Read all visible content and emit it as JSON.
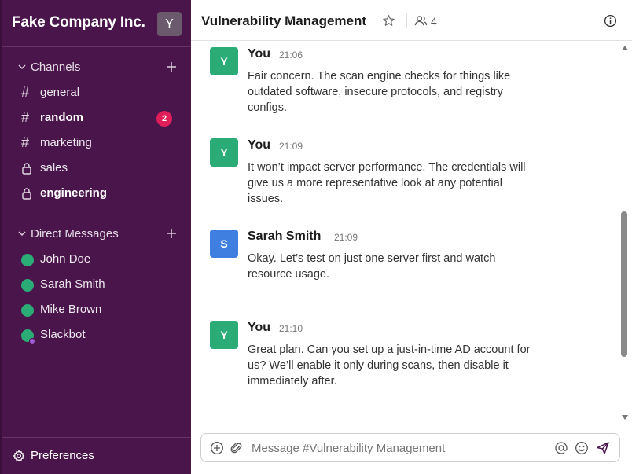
{
  "workspace": {
    "name": "Fake Company Inc.",
    "avatar_letter": "Y"
  },
  "sidebar": {
    "channels_label": "Channels",
    "channels": [
      {
        "name": "general",
        "type": "public",
        "bold": false,
        "badge": null
      },
      {
        "name": "random",
        "type": "public",
        "bold": true,
        "badge": "2"
      },
      {
        "name": "marketing",
        "type": "public",
        "bold": false,
        "badge": null
      },
      {
        "name": "sales",
        "type": "private",
        "bold": false,
        "badge": null
      },
      {
        "name": "engineering",
        "type": "private",
        "bold": true,
        "badge": null
      }
    ],
    "dm_label": "Direct Messages",
    "dms": [
      {
        "name": "John Doe",
        "status": "online"
      },
      {
        "name": "Sarah Smith",
        "status": "online"
      },
      {
        "name": "Mike Brown",
        "status": "online"
      },
      {
        "name": "Slackbot",
        "status": "online-bot"
      }
    ],
    "preferences_label": "Preferences"
  },
  "channel": {
    "title": "Vulnerability Management",
    "member_count": "4"
  },
  "messages": [
    {
      "author": "You",
      "avatar": "Y",
      "avatar_color": "#2bac76",
      "time": "21:06",
      "text": "Fair concern. The scan engine checks for things like outdated software, insecure protocols, and registry configs."
    },
    {
      "author": "You",
      "avatar": "Y",
      "avatar_color": "#2bac76",
      "time": "21:09",
      "text": "It won’t impact server performance. The credentials will give us a more representative look at any potential issues."
    },
    {
      "author": "Sarah Smith",
      "avatar": "S",
      "avatar_color": "#3f7fe0",
      "time": "21:09",
      "text": "Okay. Let’s test on just one server first and watch resource usage."
    },
    {
      "author": "You",
      "avatar": "Y",
      "avatar_color": "#2bac76",
      "time": "21:10",
      "text": "Great plan. Can you set up a just-in-time AD account for us? We’ll enable it only during scans, then disable it immediately after."
    }
  ],
  "composer": {
    "placeholder": "Message #Vulnerability Management"
  },
  "colors": {
    "sidebar_bg": "#4a154b",
    "badge": "#e01e5a",
    "online": "#2bac76",
    "send": "#4a154b"
  }
}
